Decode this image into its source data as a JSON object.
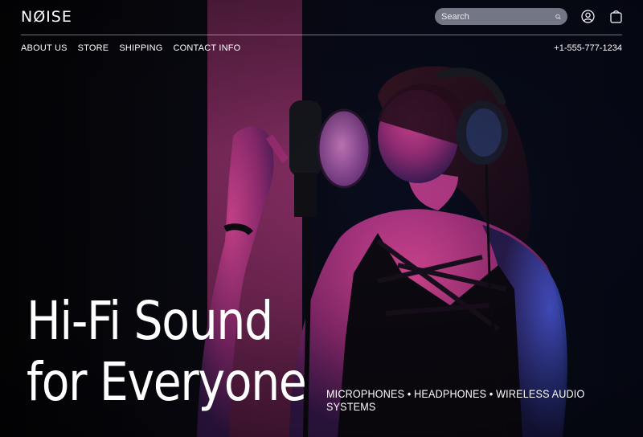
{
  "header": {
    "logo": "NØISE",
    "search": {
      "placeholder": "Search"
    },
    "icons": {
      "search": "search-icon",
      "account": "user-circle-icon",
      "cart": "shopping-bag-icon"
    }
  },
  "nav": {
    "items": [
      "ABOUT US",
      "STORE",
      "SHIPPING",
      "CONTACT INFO"
    ],
    "phone": "+1-555-777-1234"
  },
  "hero": {
    "headline_line1": "Hi-Fi Sound",
    "headline_line2": "for Everyone",
    "tagline": "MICROPHONES • HEADPHONES • WIRELESS AUDIO SYSTEMS"
  },
  "colors": {
    "background": "#07070d",
    "accent_pink": "#e0338c",
    "accent_blue": "#2a4cff"
  }
}
